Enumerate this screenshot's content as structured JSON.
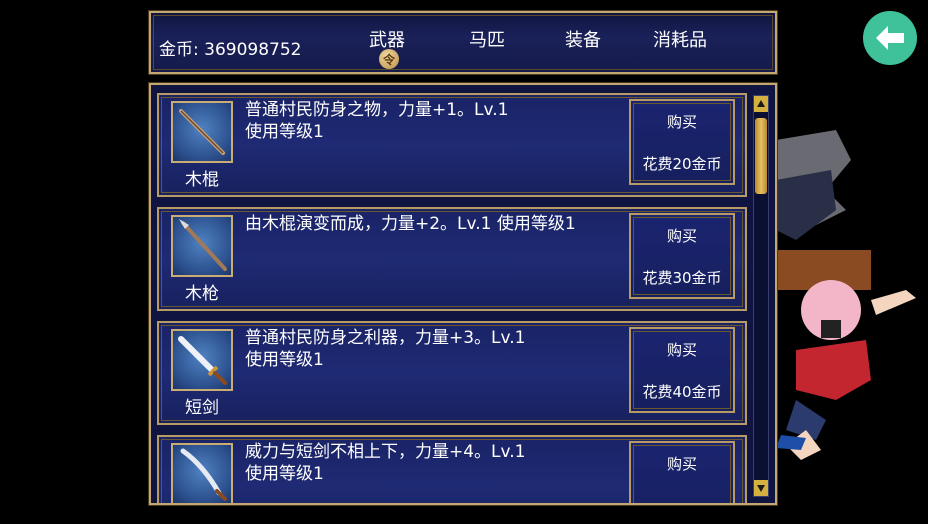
{
  "header": {
    "gold_label": "金币: 369098752",
    "tabs": [
      {
        "label": "武器",
        "active": true
      },
      {
        "label": "马匹"
      },
      {
        "label": "装备"
      },
      {
        "label": "消耗品"
      }
    ],
    "active_badge": "令"
  },
  "items": [
    {
      "name": "木棍",
      "icon": "wooden-staff-icon",
      "desc_line1": "普通村民防身之物，力量+1。Lv.1",
      "desc_line2": "使用等级1",
      "buy_label": "购买",
      "cost": "花费20金币"
    },
    {
      "name": "木枪",
      "icon": "wooden-spear-icon",
      "desc_line1": "由木棍演变而成，力量+2。Lv.1 使用等级1",
      "desc_line2": "",
      "buy_label": "购买",
      "cost": "花费30金币"
    },
    {
      "name": "短剑",
      "icon": "short-sword-icon",
      "desc_line1": "普通村民防身之利器，力量+3。Lv.1",
      "desc_line2": "使用等级1",
      "buy_label": "购买",
      "cost": "花费40金币"
    },
    {
      "name": "",
      "icon": "curved-blade-icon",
      "desc_line1": "威力与短剑不相上下，力量+4。Lv.1",
      "desc_line2": "使用等级1",
      "buy_label": "购买",
      "cost": ""
    }
  ],
  "colors": {
    "accent": "#3fc29a",
    "frame": "#c3a670",
    "panel": "#1a2366"
  },
  "back_icon": "arrow-left-icon"
}
